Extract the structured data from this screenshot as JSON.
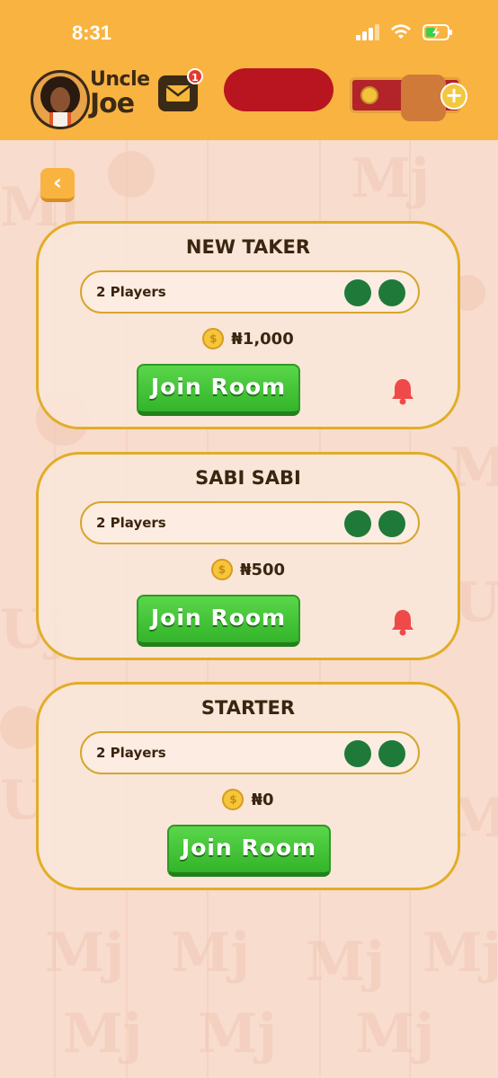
{
  "status_bar": {
    "time": "8:31"
  },
  "header": {
    "logo_line1": "Uncle",
    "logo_line2": "Joe",
    "mail_badge": "1"
  },
  "rooms": [
    {
      "title": "NEW TAKER",
      "players": "2 Players",
      "entry": "₦1,000",
      "join_label": "Join Room",
      "has_bell": true
    },
    {
      "title": "SABI SABI",
      "players": "2 Players",
      "entry": "₦500",
      "join_label": "Join Room",
      "has_bell": true
    },
    {
      "title": "STARTER",
      "players": "2 Players",
      "entry": "₦0",
      "join_label": "Join Room",
      "has_bell": false
    }
  ],
  "colors": {
    "header_bg": "#f9b340",
    "page_bg": "#f8dccd",
    "card_border": "#e2ad26",
    "join_green": "#3fc235",
    "player_dot": "#1f7a3a",
    "bell_red": "#ef4a4a"
  }
}
